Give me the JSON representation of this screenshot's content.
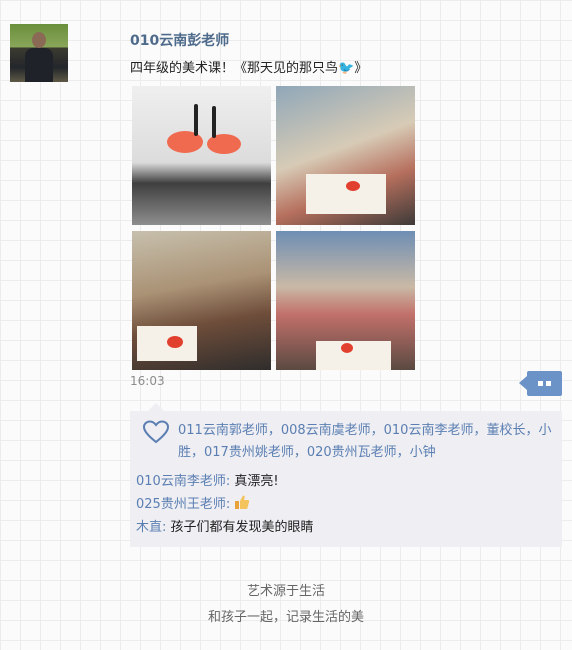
{
  "post": {
    "sender": "010云南彭老师",
    "text": "四年级的美术课！《那天见的那只鸟",
    "text_end": "》",
    "time": "16:03"
  },
  "likes": {
    "names": "011云南郭老师，008云南虞老师，010云南李老师，董校长，小胜，017贵州姚老师，020贵州瓦老师，小钟"
  },
  "comments": [
    {
      "author": "010云南李老师:",
      "text": "真漂亮!"
    },
    {
      "author": "025贵州王老师:",
      "text": ""
    },
    {
      "author": "木直:",
      "text": "孩子们都有发现美的眼睛"
    }
  ],
  "footer": {
    "line1": "艺术源于生活",
    "line2": "和孩子一起，记录生活的美"
  },
  "colors": {
    "link": "#5b7fb2",
    "more_button": "#6b93c7",
    "comment_bg": "#eeeef3"
  },
  "icons": [
    "bird-emoji-icon",
    "heart-icon",
    "thumbs-up-emoji-icon",
    "more-dots-icon"
  ]
}
